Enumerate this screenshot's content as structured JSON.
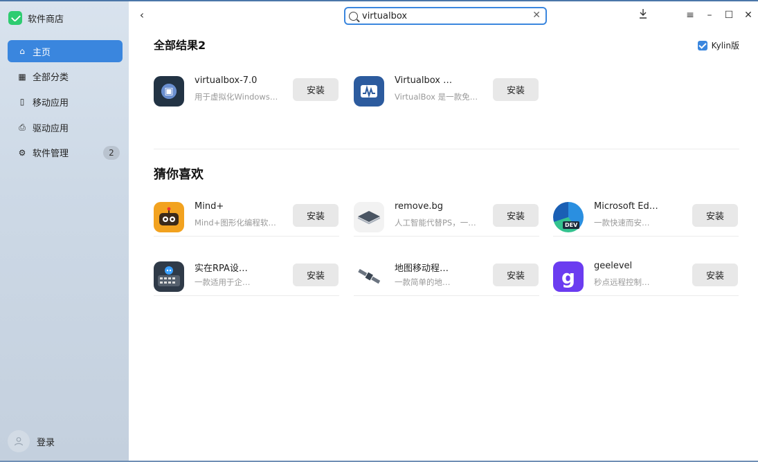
{
  "app": {
    "name": "软件商店"
  },
  "sidebar": {
    "items": [
      {
        "label": "主页",
        "icon": "home-icon",
        "glyph": "⌂",
        "active": true
      },
      {
        "label": "全部分类",
        "icon": "grid-icon",
        "glyph": "▦",
        "active": false
      },
      {
        "label": "移动应用",
        "icon": "phone-icon",
        "glyph": "▯",
        "active": false
      },
      {
        "label": "驱动应用",
        "icon": "printer-icon",
        "glyph": "⎙",
        "active": false
      },
      {
        "label": "软件管理",
        "icon": "gear-icon",
        "glyph": "⚙",
        "active": false,
        "badge": "2"
      }
    ],
    "login_label": "登录"
  },
  "search": {
    "value": "virtualbox"
  },
  "kylin": {
    "label": "Kylin版",
    "checked": true
  },
  "sections": {
    "all_results": "全部结果2",
    "guess": "猜你喜欢"
  },
  "install_label": "安装",
  "results": [
    {
      "name": "virtualbox-7.0",
      "desc": "用于虚拟化Windows…",
      "icon": "virtualbox-icon"
    },
    {
      "name": "Virtualbox …",
      "desc": "VirtualBox 是一款免…",
      "icon": "virtualbox-monitor-icon"
    }
  ],
  "recommendations": [
    {
      "name": "Mind+",
      "desc": "Mind+图形化编程软…",
      "icon": "mind-plus-icon"
    },
    {
      "name": "remove.bg",
      "desc": "人工智能代替PS，一…",
      "icon": "remove-bg-icon"
    },
    {
      "name": "Microsoft Ed…",
      "desc": "一款快速而安…",
      "icon": "edge-dev-icon"
    },
    {
      "name": "实在RPA设…",
      "desc": "一款适用于企…",
      "icon": "rpa-robot-icon"
    },
    {
      "name": "地图移动程…",
      "desc": "一款简单的地…",
      "icon": "satellite-icon"
    },
    {
      "name": "geelevel",
      "desc": "秒点远程控制…",
      "icon": "geelevel-icon"
    }
  ],
  "colors": {
    "accent": "#3a86de"
  }
}
